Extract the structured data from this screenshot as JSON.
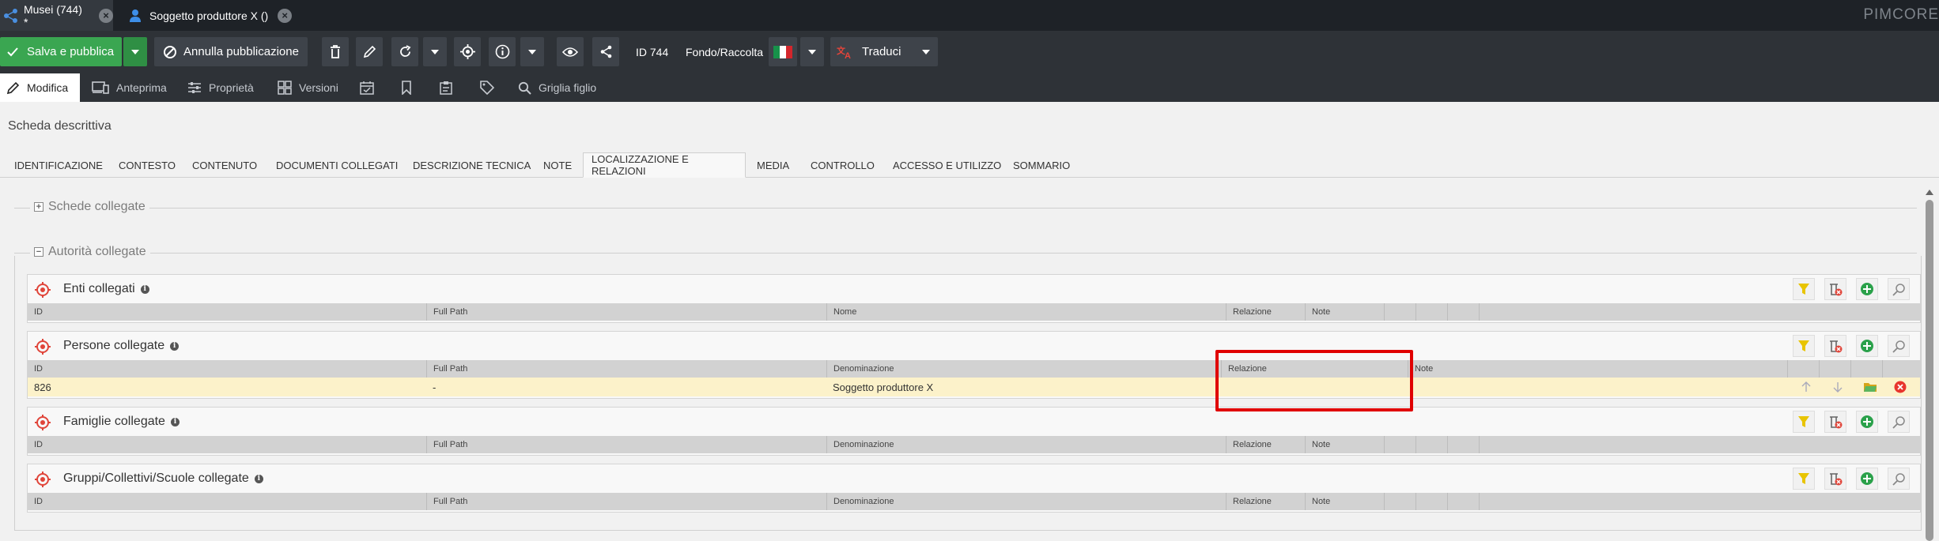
{
  "top_tabs": [
    {
      "label": "Musei (744) *",
      "icon": "tree-icon"
    },
    {
      "label": "Soggetto produttore X ()",
      "icon": "person-icon"
    }
  ],
  "brand": "PIMCORE",
  "toolbar": {
    "save_publish": "Salva e pubblica",
    "unpublish": "Annulla pubblicazione",
    "id_label": "ID 744",
    "type_label": "Fondo/Raccolta",
    "translate": "Traduci"
  },
  "edit_tabs": {
    "edit": "Modifica",
    "preview": "Anteprima",
    "properties": "Proprietà",
    "versions": "Versioni",
    "child_grid": "Griglia figlio"
  },
  "scheda_title": "Scheda descrittiva",
  "section_tabs": [
    "IDENTIFICAZIONE",
    "CONTESTO",
    "CONTENUTO",
    "DOCUMENTI COLLEGATI",
    "DESCRIZIONE TECNICA",
    "NOTE",
    "LOCALIZZAZIONE E RELAZIONI",
    "MEDIA",
    "CONTROLLO",
    "ACCESSO E UTILIZZO",
    "SOMMARIO"
  ],
  "active_section_tab": "LOCALIZZAZIONE E RELAZIONI",
  "fieldsets": {
    "schede": "Schede collegate",
    "autorita": "Autorità collegate"
  },
  "panels": {
    "enti": {
      "title": "Enti collegati",
      "columns": [
        "ID",
        "Full Path",
        "Nome",
        "Relazione",
        "Note"
      ]
    },
    "persone": {
      "title": "Persone collegate",
      "columns": [
        "ID",
        "Full Path",
        "Denominazione",
        "Relazione",
        "Note"
      ],
      "row": {
        "id": "826",
        "full_path": "-",
        "denominazione": "Soggetto produttore X",
        "relazione": "",
        "note": ""
      }
    },
    "famiglie": {
      "title": "Famiglie collegate",
      "columns": [
        "ID",
        "Full Path",
        "Denominazione",
        "Relazione",
        "Note"
      ]
    },
    "gruppi": {
      "title": "Gruppi/Collettivi/Scuole collegate",
      "columns": [
        "ID",
        "Full Path",
        "Denominazione",
        "Relazione",
        "Note"
      ]
    }
  },
  "colors": {
    "accent_green": "#3aa651",
    "toolbar_bg": "#2e3237",
    "row_highlight": "#fcf2ca",
    "annotation_red": "#e00000"
  }
}
